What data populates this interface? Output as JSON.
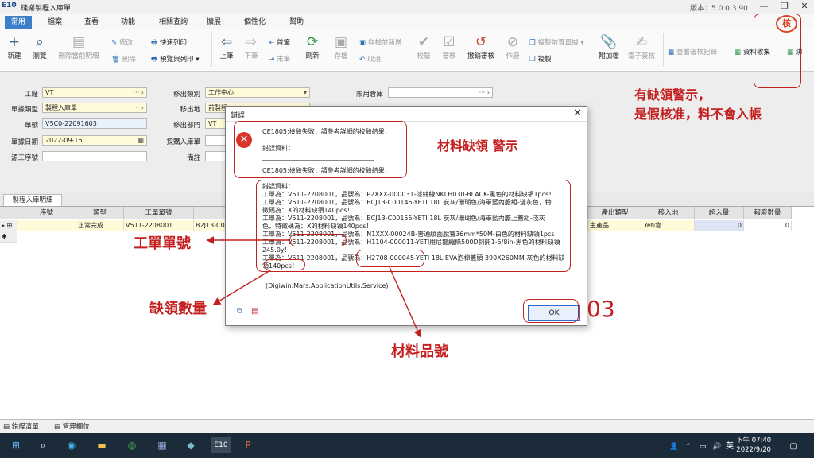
{
  "window": {
    "logo": "E10",
    "title": "鏈謝製程入庫單",
    "version": "版本：5.0.0.3.90",
    "min": "—",
    "restore": "❐",
    "close": "✕"
  },
  "menus": [
    "常用",
    "檔案",
    "查看",
    "功能",
    "相關查詢",
    "擴展",
    "個性化",
    "幫助"
  ],
  "toolbar": {
    "new": "新建",
    "browse": "瀏覽",
    "delete_detail": "刪除當前明細",
    "edit": "修改",
    "delete": "刪除",
    "quick_print": "快速列印",
    "preview_print": "預覽與列印 ▾",
    "prev": "上筆",
    "next": "下筆",
    "first": "首筆",
    "last": "末筆",
    "refresh": "刷新",
    "save": "存檔",
    "save_add": "存檔並新增",
    "cancel": "取消",
    "validate": "校驗",
    "approve": "審核",
    "unapprove": "撤銷審核",
    "void": "作廢",
    "copy_before": "複製前置單據 ▾",
    "copy": "複製",
    "attach": "附加檔",
    "esign": "電子簽核",
    "view_log": "查看審核記錄",
    "collect": "資料收集",
    "bind": "綁"
  },
  "form": {
    "factory_label": "工廠",
    "factory_value": "VT",
    "doc_type_label": "單據類型",
    "doc_type_value": "製程入庫單",
    "doc_no_label": "單號",
    "doc_no_value": "V5C0-22091603",
    "doc_date_label": "單據日期",
    "doc_date_value": "2022-09-16",
    "source_label": "源工序號",
    "source_value": "",
    "transfer_type_label": "移出類別",
    "transfer_type_value": "工作中心",
    "transfer_place_label": "移出地",
    "transfer_place_value": "前製程",
    "transfer_dept_label": "移出部門",
    "transfer_dept_value": "VT",
    "purchase_label": "採購入庫單",
    "purchase_value": "",
    "remark_label": "備註",
    "remark_value": "",
    "limit_wh_label": "限用倉庫",
    "limit_wh_value": ""
  },
  "grid": {
    "tab": "製程入庫明細",
    "headers": [
      "序號",
      "類型",
      "工單單號",
      "產品",
      "產出類型",
      "移入地",
      "超入量",
      "報廢數量"
    ],
    "row": {
      "seq": "1",
      "type": "正常完成",
      "wo": "V511-2208001",
      "product": "B2J13-C0",
      "out_type": "主產品",
      "dest": "Yeti倉",
      "over": "0",
      "scrap": "0"
    }
  },
  "bottom_tabs": [
    "錯誤清單",
    "管理欄位"
  ],
  "dialog": {
    "title": "錯誤",
    "msg1": "CE1805:檢驗失敗，請參考詳細的校驗結果：",
    "err_label": "錯誤資料：",
    "msg2": "CE1805:檢驗失敗，請參考詳細的校驗結果：",
    "detail_label": "錯誤資料：",
    "lines": [
      "工單為：V511-2208001，品號為：P2XXX-000031-漆絲線NKLH030-BLACK-黑色的材料缺領1pcs！",
      "工單為：V511-2208001，品號為：BCJ13-C00145-YETI 18L 炭灰/珊瑚色/海軍藍內膽組-淺灰色，特",
      "徵碼為：X的材料缺領140pcs！",
      "工單為：V511-2208001，品號為：BCJ13-C00155-YETI 18L 炭灰/珊瑚色/海軍藍內膽上蓋組-淺灰",
      "色，特徵碼為：X的材料缺領140pcs！",
      "工單為：V511-2208001，品號為：N1XXX-00024B-普通紋面脫寬36mm*50M-白色的材料缺領1pcs！",
      "工單為：V511-2208001，品號為：H1104-000011-YETI用尼龍繩條500D斜開1-5/8in-黑色的材料缺領",
      "245.0y！",
      "工單為：V511-2208001，品號為：H2708-000045-YETI 18L EVA泡棉蓋頭 390X260MM-灰色的材料缺",
      "領140pcs！"
    ],
    "service": "(Digiwin.Mars.ApplicationUtils.Service)",
    "ok": "OK"
  },
  "annotations": {
    "warn_line1": "有缺領警示，",
    "warn_line2": "是假核准，料不會入帳",
    "material_short": "材料缺領 警示",
    "wo_no": "工單單號",
    "short_qty": "缺領數量",
    "item_no": "材料品號",
    "step": "03",
    "stamp": "核"
  },
  "taskbar": {
    "time": "下午 07:40",
    "date": "2022/9/20",
    "ime": "英"
  }
}
